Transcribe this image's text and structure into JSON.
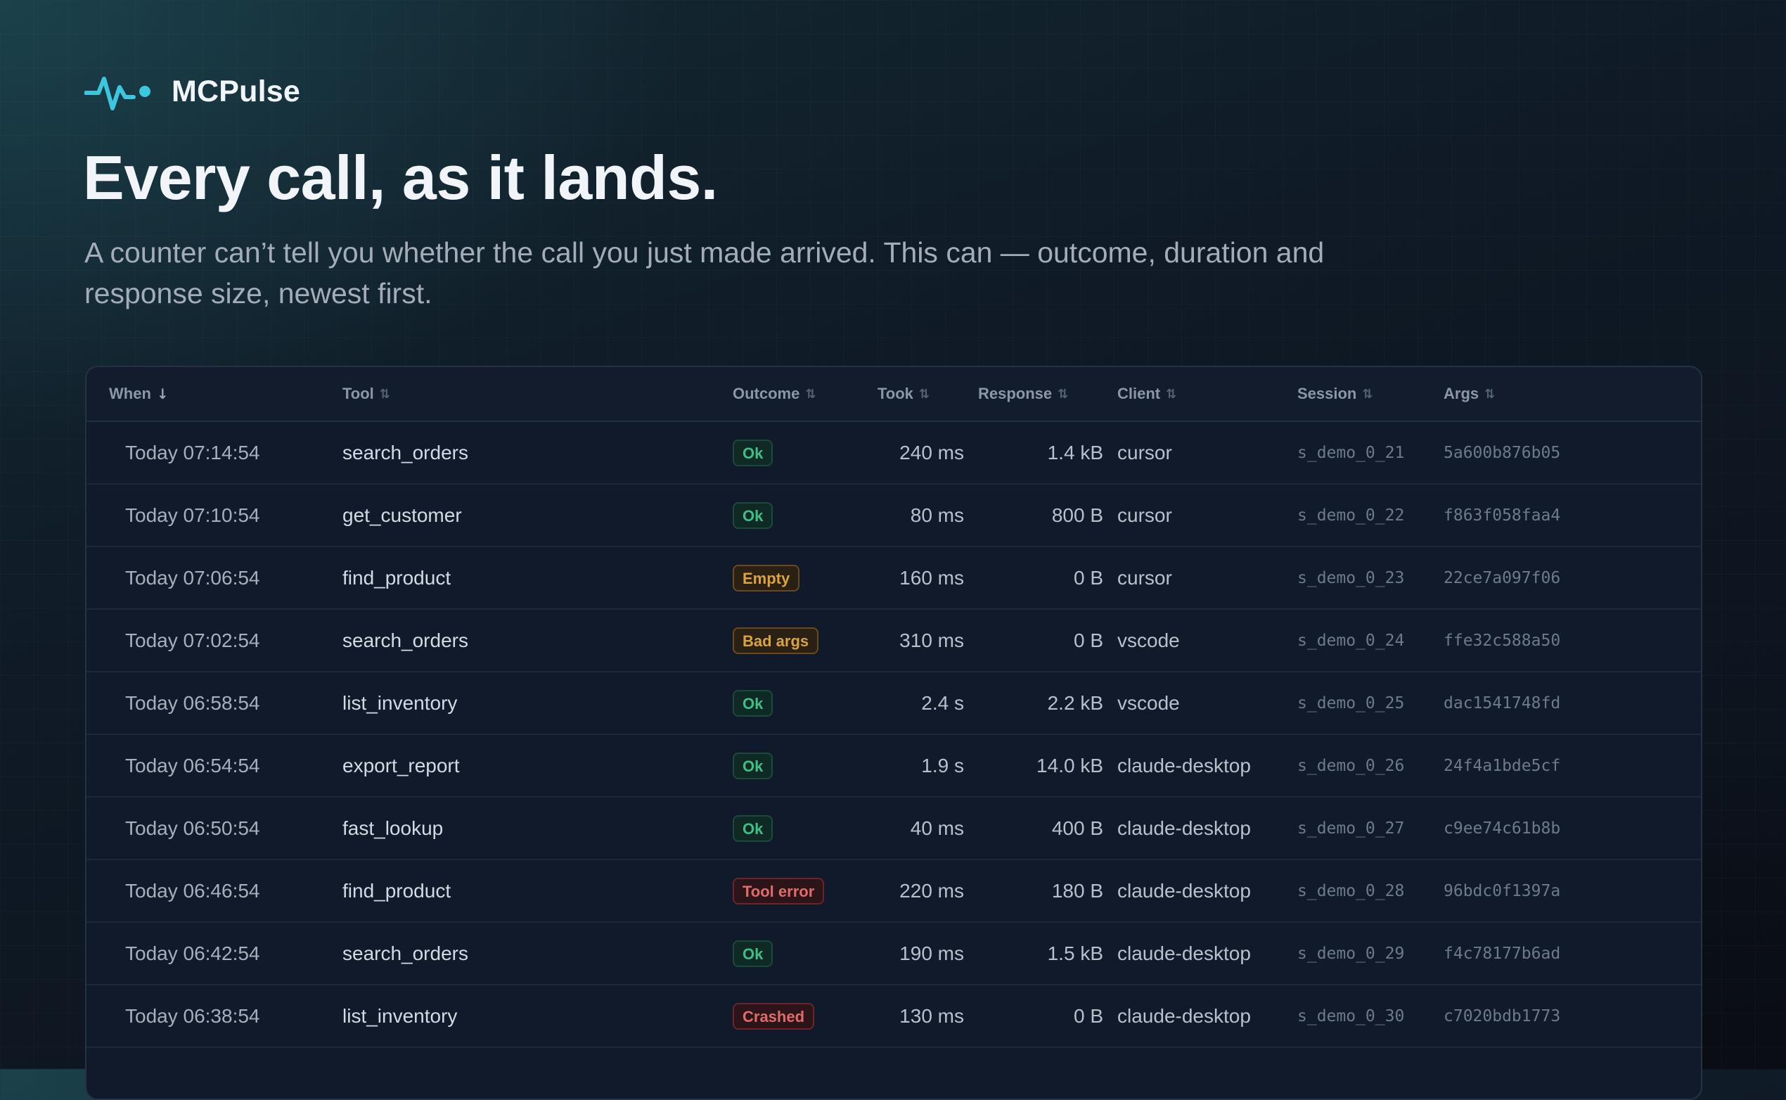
{
  "brand": {
    "name": "MCPulse",
    "icon": "pulse-icon",
    "accent": "#3cc7e0"
  },
  "hero": {
    "title": "Every call, as it lands.",
    "subtitle": "A counter can’t tell you whether the call you just made arrived. This can — outcome, duration and response size, newest first."
  },
  "table": {
    "columns": [
      {
        "key": "when",
        "label": "When",
        "sort": "desc"
      },
      {
        "key": "tool",
        "label": "Tool",
        "sort": "none"
      },
      {
        "key": "outcome",
        "label": "Outcome",
        "sort": "none"
      },
      {
        "key": "took",
        "label": "Took",
        "sort": "none"
      },
      {
        "key": "response",
        "label": "Response",
        "sort": "none"
      },
      {
        "key": "client",
        "label": "Client",
        "sort": "none"
      },
      {
        "key": "session",
        "label": "Session",
        "sort": "none"
      },
      {
        "key": "args",
        "label": "Args",
        "sort": "none"
      }
    ],
    "sort_icons": {
      "desc": "↓",
      "none": "⇅"
    },
    "rows": [
      {
        "when": "Today 07:14:54",
        "tool": "search_orders",
        "outcome": "Ok",
        "status": "ok",
        "took": "240 ms",
        "response": "1.4 kB",
        "client": "cursor",
        "session": "s_demo_0_21",
        "args": "5a600b876b05"
      },
      {
        "when": "Today 07:10:54",
        "tool": "get_customer",
        "outcome": "Ok",
        "status": "ok",
        "took": "80 ms",
        "response": "800 B",
        "client": "cursor",
        "session": "s_demo_0_22",
        "args": "f863f058faa4"
      },
      {
        "when": "Today 07:06:54",
        "tool": "find_product",
        "outcome": "Empty",
        "status": "warn",
        "took": "160 ms",
        "response": "0 B",
        "client": "cursor",
        "session": "s_demo_0_23",
        "args": "22ce7a097f06"
      },
      {
        "when": "Today 07:02:54",
        "tool": "search_orders",
        "outcome": "Bad args",
        "status": "warn",
        "took": "310 ms",
        "response": "0 B",
        "client": "vscode",
        "session": "s_demo_0_24",
        "args": "ffe32c588a50"
      },
      {
        "when": "Today 06:58:54",
        "tool": "list_inventory",
        "outcome": "Ok",
        "status": "ok",
        "took": "2.4 s",
        "response": "2.2 kB",
        "client": "vscode",
        "session": "s_demo_0_25",
        "args": "dac1541748fd"
      },
      {
        "when": "Today 06:54:54",
        "tool": "export_report",
        "outcome": "Ok",
        "status": "ok",
        "took": "1.9 s",
        "response": "14.0 kB",
        "client": "claude-desktop",
        "session": "s_demo_0_26",
        "args": "24f4a1bde5cf"
      },
      {
        "when": "Today 06:50:54",
        "tool": "fast_lookup",
        "outcome": "Ok",
        "status": "ok",
        "took": "40 ms",
        "response": "400 B",
        "client": "claude-desktop",
        "session": "s_demo_0_27",
        "args": "c9ee74c61b8b"
      },
      {
        "when": "Today 06:46:54",
        "tool": "find_product",
        "outcome": "Tool error",
        "status": "err",
        "took": "220 ms",
        "response": "180 B",
        "client": "claude-desktop",
        "session": "s_demo_0_28",
        "args": "96bdc0f1397a"
      },
      {
        "when": "Today 06:42:54",
        "tool": "search_orders",
        "outcome": "Ok",
        "status": "ok",
        "took": "190 ms",
        "response": "1.5 kB",
        "client": "claude-desktop",
        "session": "s_demo_0_29",
        "args": "f4c78177b6ad"
      },
      {
        "when": "Today 06:38:54",
        "tool": "list_inventory",
        "outcome": "Crashed",
        "status": "err",
        "took": "130 ms",
        "response": "0 B",
        "client": "claude-desktop",
        "session": "s_demo_0_30",
        "args": "c7020bdb1773"
      }
    ]
  },
  "colors": {
    "ok": "#3fbf84",
    "warn": "#d9a43f",
    "err": "#e06b6b"
  }
}
